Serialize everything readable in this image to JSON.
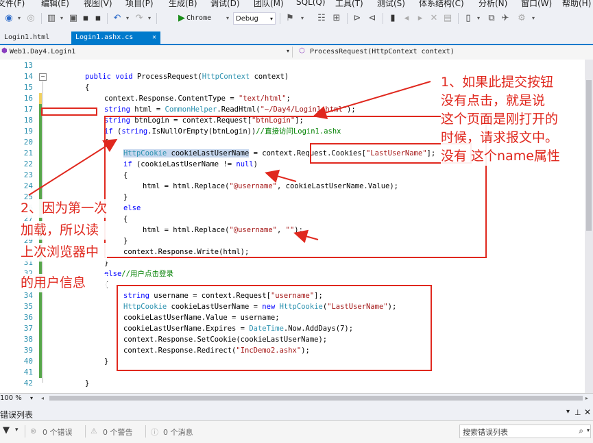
{
  "menu": [
    "文件(F)",
    "编辑(E)",
    "视图(V)",
    "项目(P)",
    "生成(B)",
    "调试(D)",
    "团队(M)",
    "SQL(Q)",
    "工具(T)",
    "测试(S)",
    "体系结构(C)",
    "分析(N)",
    "窗口(W)",
    "帮助(H)"
  ],
  "toolbar": {
    "start_label": "Chrome",
    "config_value": "Debug"
  },
  "tabs": [
    {
      "label": "Login1.html"
    },
    {
      "label": "Login1.ashx.cs",
      "close": "✕"
    }
  ],
  "navbar": {
    "left": "Web1.Day4.Login1",
    "right": "ProcessRequest(HttpContext context)"
  },
  "line_numbers": [
    "13",
    "14",
    "15",
    "16",
    "17",
    "18",
    "19",
    "20",
    "21",
    "22",
    "23",
    "24",
    "25",
    "26",
    "27",
    "28",
    "29",
    "30",
    "31",
    "32",
    "33",
    "34",
    "35",
    "36",
    "37",
    "38",
    "39",
    "40",
    "41",
    "42"
  ],
  "annotations": {
    "note1": [
      "1、如果此提交按钮",
      "没有点击，就是说",
      "这个页面是刚打开的",
      "时候，请求报文中。",
      "没有 这个name属性"
    ],
    "note2": [
      "2、因为第一次",
      "加载，所以读",
      "上次浏览器中",
      "的用户信息"
    ]
  },
  "zoom": "100 %",
  "error_list": {
    "title": "错误列表",
    "errors": "0 个错误",
    "warnings": "0 个警告",
    "messages": "0 个消息",
    "search_placeholder": "搜索错误列表"
  },
  "colors": {
    "accent": "#007acc",
    "annotation": "#e0281e",
    "keyword": "#0000ff",
    "type": "#2b91af",
    "string": "#a31515",
    "comment": "#008000"
  }
}
